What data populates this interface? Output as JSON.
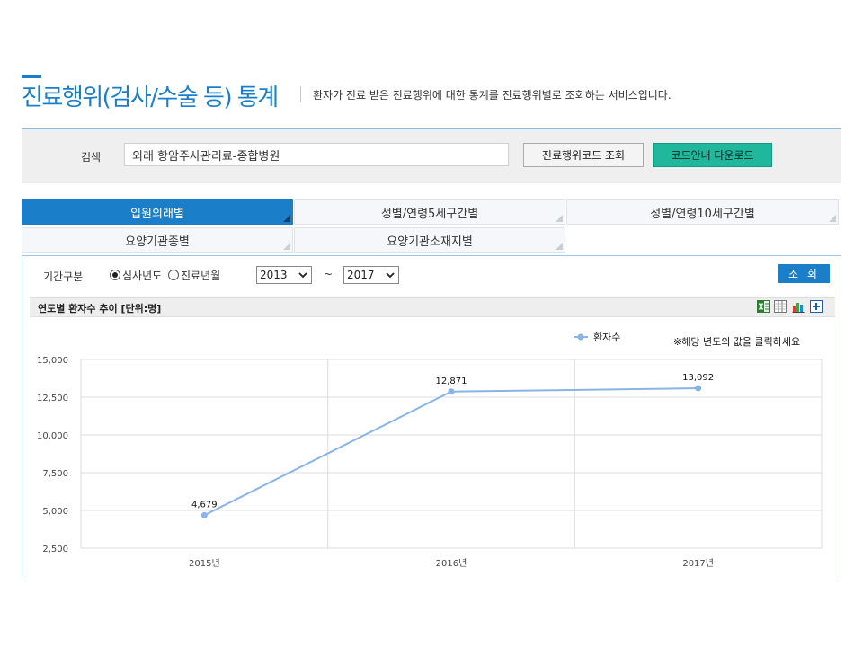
{
  "header": {
    "title": "진료행위(검사/수술 등) 통계",
    "description": "환자가 진료 받은 진료행위에 대한 통계를 진료행위별로 조회하는 서비스입니다."
  },
  "search": {
    "label": "검색",
    "value": "외래 항암주사관리료-종합병원",
    "code_search_label": "진료행위코드 조회",
    "code_download_label": "코드안내 다운로드"
  },
  "tabs": [
    {
      "label": "입원외래별",
      "active": true
    },
    {
      "label": "성별/연령5세구간별"
    },
    {
      "label": "성별/연령10세구간별"
    },
    {
      "label": "요양기관종별"
    },
    {
      "label": "요양기관소재지별"
    }
  ],
  "filter": {
    "period_label": "기간구분",
    "radio_review_year": "심사년도",
    "radio_treatment_month": "진료년월",
    "from_year": "2013",
    "tilde": "~",
    "to_year": "2017",
    "query_label": "조 회"
  },
  "chart_section": {
    "title": "연도별 환자수 추이 [단위:명]",
    "note": "※해당 년도의 값을 클릭하세요"
  },
  "colors": {
    "accent": "#1a7fc8",
    "download_button": "#1fb89d",
    "series_line": "#8ab4e6"
  },
  "icons": [
    "excel-icon",
    "grid-table-icon",
    "bar-chart-icon",
    "expand-plus-icon",
    "chevron-down-icon"
  ],
  "chart_data": {
    "type": "line",
    "categories": [
      "2015년",
      "2016년",
      "2017년"
    ],
    "series": [
      {
        "name": "환자수",
        "values": [
          4679,
          12871,
          13092
        ]
      }
    ],
    "data_labels": [
      "4,679",
      "12,871",
      "13,092"
    ],
    "ylim": [
      2500,
      15000
    ],
    "y_ticks": [
      2500,
      5000,
      7500,
      10000,
      12500,
      15000
    ],
    "y_tick_labels": [
      "2,500",
      "5,000",
      "7,500",
      "10,000",
      "12,500",
      "15,000"
    ],
    "xlabel": "",
    "ylabel": "",
    "grid": true,
    "legend_position": "top-right"
  }
}
